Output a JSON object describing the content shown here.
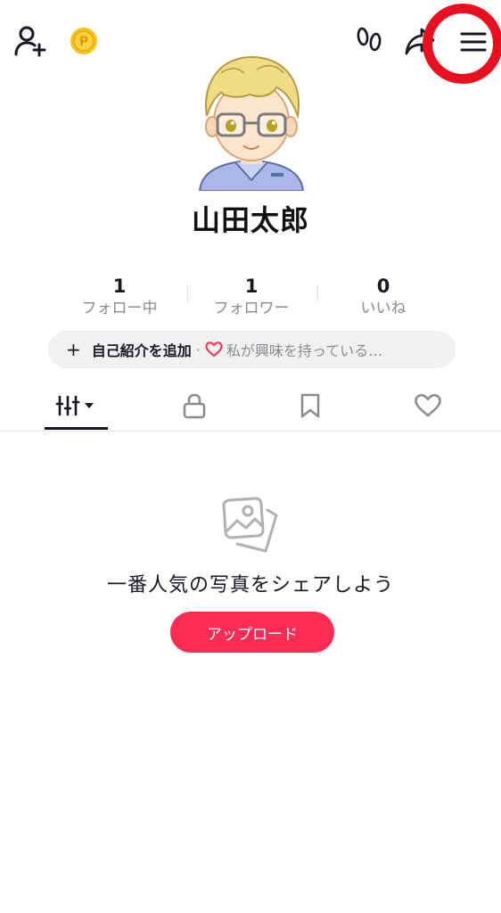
{
  "header": {
    "icons": [
      "add-friend-icon",
      "coin-icon",
      "footprints-icon",
      "share-icon",
      "menu-icon"
    ],
    "coin_letter": "P"
  },
  "profile": {
    "name": "山田太郎"
  },
  "stats": [
    {
      "value": "1",
      "label": "フォロー中"
    },
    {
      "value": "1",
      "label": "フォロワー"
    },
    {
      "value": "0",
      "label": "いいね"
    }
  ],
  "bio": {
    "plus": "+",
    "add_label": "自己紹介を追加",
    "separator": "·",
    "interest_label": "私が興味を持っている…"
  },
  "tabs": [
    "videos-grid-icon",
    "lock-icon",
    "bookmark-icon",
    "heart-icon"
  ],
  "empty_state": {
    "message": "一番人気の写真をシェアしよう",
    "upload_label": "アップロード"
  },
  "colors": {
    "accent": "#fe2c55",
    "highlight": "#e8101e",
    "text": "#161823",
    "muted": "#8a8b91"
  }
}
